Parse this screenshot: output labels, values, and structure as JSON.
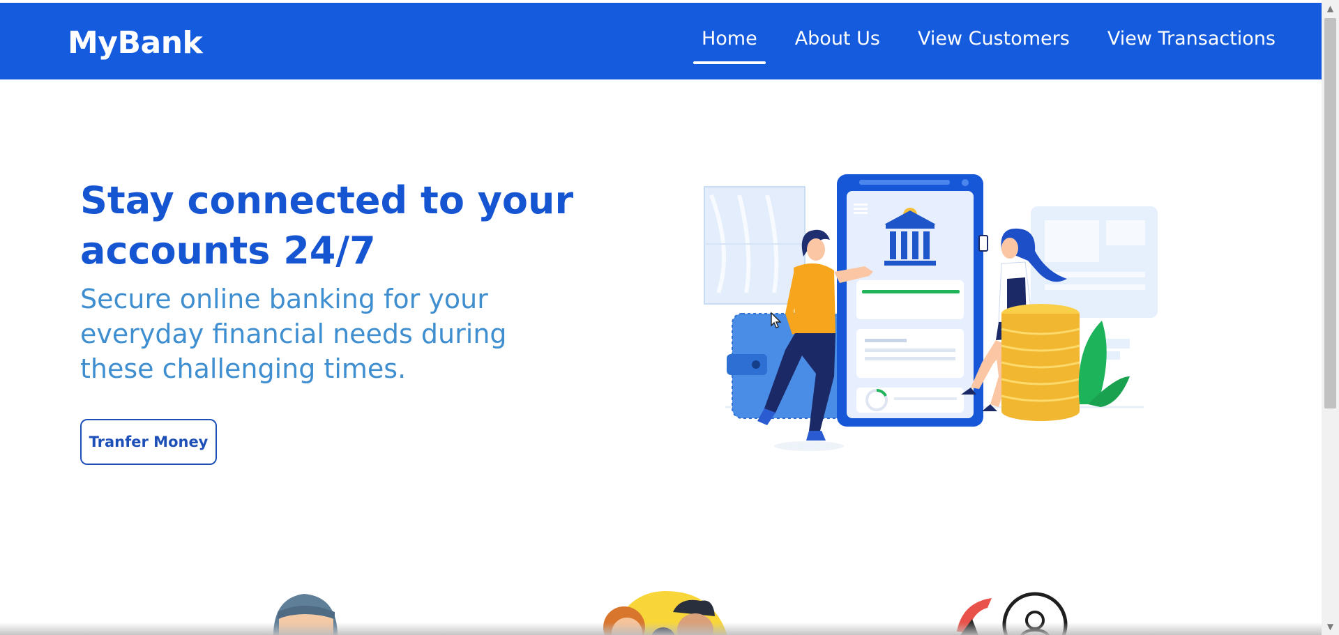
{
  "brand": "MyBank",
  "nav": {
    "home": "Home",
    "about": "About Us",
    "customers": "View Customers",
    "transactions": "View Transactions"
  },
  "hero": {
    "title": "Stay connected to your accounts 24/7",
    "subtitle": "Secure online banking for your everyday financial needs during these challenging times.",
    "cta": "Tranfer Money"
  },
  "icons": {
    "scroll_up": "scroll-up-arrow-icon",
    "scroll_down": "scroll-down-arrow-icon",
    "illustration": "online-banking-illustration",
    "feature_1": "user-avatar-icon",
    "feature_2": "customers-group-icon",
    "feature_3": "money-transfer-icon"
  },
  "colors": {
    "navbar": "#155bdd",
    "title": "#1655d1",
    "subtitle": "#3f8fd0",
    "button_border": "#1c4fb8"
  }
}
